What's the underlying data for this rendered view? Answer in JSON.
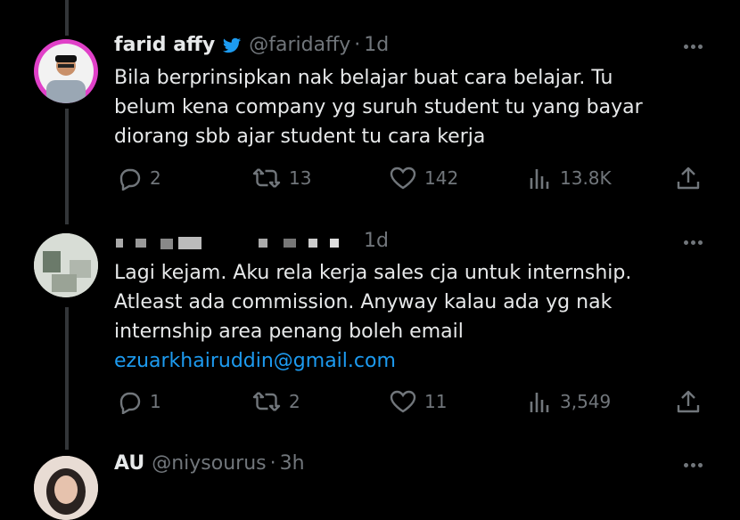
{
  "tweets": [
    {
      "name": "farid affy",
      "handle": "@faridaffy",
      "time": "1d",
      "lines": [
        "Bila berprinsipkan nak belajar buat cara belajar. Tu",
        "belum kena company yg suruh student tu yang bayar",
        "diorang sbb ajar student tu cara kerja"
      ],
      "replies": "2",
      "retweets": "13",
      "likes": "142",
      "views": "13.8K"
    },
    {
      "name": "",
      "handle": "",
      "time": "1d",
      "lines": [
        "Lagi kejam. Aku rela kerja sales cja untuk internship.",
        "Atleast ada commission. Anyway kalau ada yg nak",
        "internship area penang boleh email"
      ],
      "link": "ezuarkhairuddin@gmail.com",
      "replies": "1",
      "retweets": "2",
      "likes": "11",
      "views": "3,549"
    },
    {
      "name": "AU",
      "handle": "@niysourus",
      "time": "3h"
    }
  ],
  "colors": {
    "background": "#000000",
    "text": "#e7e9ea",
    "muted": "#71767b",
    "link": "#1d9bf0",
    "verified": "#1d9bf0",
    "avatar_ring": "#e040c8"
  }
}
